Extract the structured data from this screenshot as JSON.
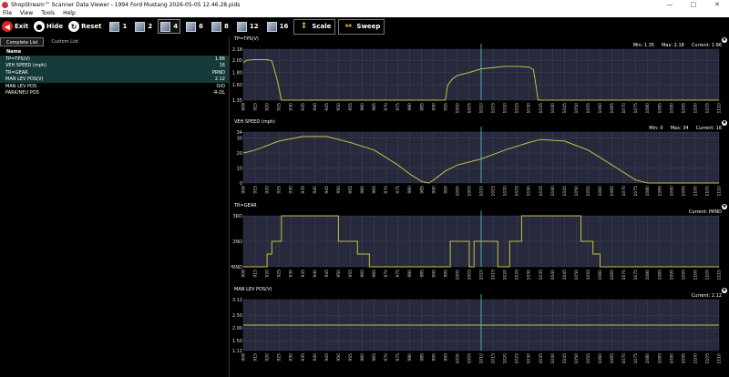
{
  "window": {
    "title": "ShopStream™ Scanner Data Viewer - 1994 Ford Mustang 2026-05-05 12.46.28.pids"
  },
  "menu": [
    "File",
    "View",
    "Tools",
    "Help"
  ],
  "toolbar": {
    "exit_label": "Exit",
    "hide_label": "Hide",
    "reset_label": "Reset",
    "layouts": [
      "1",
      "2",
      "4",
      "6",
      "8",
      "12",
      "16"
    ],
    "active_layout": "4",
    "scale_label": "Scale",
    "sweep_label": "Sweep"
  },
  "left_panel": {
    "tabs": [
      "Complete List",
      "Custom List"
    ],
    "active_tab": "Complete List",
    "list_header": "Name",
    "items": [
      {
        "name": "TP=TPS(V)",
        "value": "1.86",
        "selected": true
      },
      {
        "name": "VEH SPEED (mph)",
        "value": "16",
        "selected": true
      },
      {
        "name": "TR=GEAR",
        "value": "PRND",
        "selected": true
      },
      {
        "name": "MAN LEV POS(V)",
        "value": "2.12",
        "selected": true
      },
      {
        "name": "MAN LEV POS",
        "value": "O/D",
        "selected": false
      },
      {
        "name": "PARK/NEU POS",
        "value": "-R-DL",
        "selected": false
      }
    ]
  },
  "x_ticks": [
    "908",
    "915",
    "920",
    "925",
    "930",
    "935",
    "940",
    "945",
    "950",
    "955",
    "960",
    "965",
    "970",
    "975",
    "980",
    "985",
    "990",
    "995",
    "1000",
    "1005",
    "1010",
    "1015",
    "1020",
    "1025",
    "1030",
    "1035",
    "1040",
    "1045",
    "1050",
    "1055",
    "1060",
    "1065",
    "1070",
    "1075",
    "1080",
    "1085",
    "1090",
    "1095",
    "1100",
    "1105",
    "1110"
  ],
  "cursor_value": 1010,
  "colors": {
    "trace": "#c8c043",
    "cursor": "#5cc8d8",
    "plot_bg": "#262a3c",
    "grid": "#555a6e"
  },
  "chart_data": [
    {
      "type": "line",
      "title": "TP=TPS(V)",
      "stats": {
        "min": "Min: 1.35",
        "max": "Max: 2.18",
        "current": "Current: 1.86"
      },
      "ylim": [
        1.35,
        2.18
      ],
      "y_ticks": [
        "2.18",
        "2.00",
        "1.80",
        "1.60",
        "1.35"
      ],
      "y_tick_values": [
        2.18,
        2.0,
        1.8,
        1.6,
        1.35
      ],
      "x": [
        908,
        910,
        915,
        920,
        922,
        924,
        925,
        926,
        928,
        995,
        996,
        998,
        1000,
        1005,
        1010,
        1015,
        1020,
        1025,
        1030,
        1032,
        1033,
        1034,
        1040,
        1060,
        1080,
        1100,
        1110
      ],
      "y": [
        1.96,
        2.0,
        2.01,
        2.01,
        1.99,
        1.72,
        1.55,
        1.35,
        1.35,
        1.35,
        1.6,
        1.7,
        1.75,
        1.8,
        1.86,
        1.88,
        1.9,
        1.9,
        1.89,
        1.85,
        1.6,
        1.35,
        1.35,
        1.35,
        1.35,
        1.35,
        1.35
      ]
    },
    {
      "type": "line",
      "title": "VEH SPEED (mph)",
      "stats": {
        "min": "Min: 0",
        "max": "Max: 34",
        "current": "Current: 16"
      },
      "ylim": [
        0,
        34
      ],
      "y_ticks": [
        "34",
        "30",
        "20",
        "10",
        "0"
      ],
      "y_tick_values": [
        34,
        30,
        20,
        10,
        0
      ],
      "x": [
        908,
        915,
        925,
        935,
        945,
        955,
        965,
        975,
        980,
        985,
        988,
        990,
        995,
        1000,
        1010,
        1020,
        1030,
        1035,
        1045,
        1055,
        1065,
        1075,
        1080,
        1090,
        1100,
        1110
      ],
      "y": [
        20,
        22,
        28,
        31,
        31,
        27,
        22,
        12,
        6,
        1,
        0,
        2,
        8,
        12,
        16,
        22,
        27,
        29,
        28,
        22,
        12,
        2,
        0,
        0,
        0,
        0
      ]
    },
    {
      "type": "line",
      "title": "TR=GEAR",
      "stats": {
        "current": "Current: PRND"
      },
      "categories": [
        "PRND",
        "2ND",
        "3RD"
      ],
      "y_ticks": [
        "3RD",
        "2ND",
        "PRND"
      ],
      "y_tick_values": [
        2,
        1,
        0
      ],
      "ylim": [
        0,
        2
      ],
      "x": [
        908,
        920,
        920,
        922,
        922,
        926,
        926,
        950,
        950,
        958,
        958,
        963,
        963,
        997,
        997,
        1000,
        1000,
        1005,
        1005,
        1007,
        1007,
        1017,
        1017,
        1022,
        1022,
        1027,
        1027,
        1052,
        1052,
        1057,
        1057,
        1060,
        1060,
        1110
      ],
      "y": [
        0,
        0,
        0.5,
        0.5,
        1,
        1,
        2,
        2,
        1,
        1,
        0.5,
        0.5,
        0,
        0,
        1,
        1,
        1,
        1,
        0,
        0,
        1,
        1,
        0,
        0,
        1,
        1,
        2,
        2,
        1,
        1,
        0.5,
        0.5,
        0,
        0
      ]
    },
    {
      "type": "line",
      "title": "MAN LEV POS(V)",
      "stats": {
        "current": "Current: 2.12"
      },
      "ylim": [
        1.12,
        3.12
      ],
      "y_ticks": [
        "3.12",
        "2.50",
        "2.00",
        "1.50",
        "1.12"
      ],
      "y_tick_values": [
        3.12,
        2.5,
        2.0,
        1.5,
        1.12
      ],
      "x": [
        908,
        1110
      ],
      "y": [
        2.12,
        2.12
      ]
    }
  ]
}
